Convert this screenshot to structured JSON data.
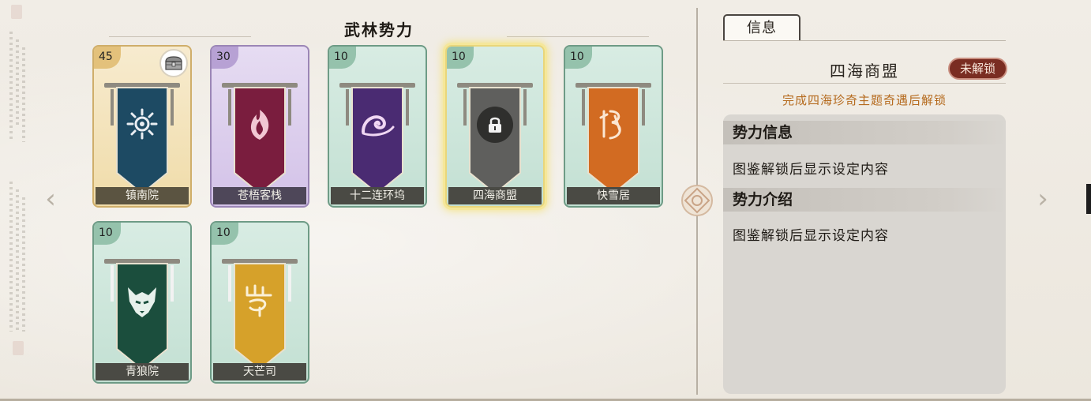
{
  "header": {
    "title": "武林势力"
  },
  "factions": [
    {
      "name": "镇南院",
      "level": "45",
      "theme": "gold",
      "emblem": "sun-emblem-icon",
      "banner_color": "#1d4a63",
      "has_reward": true
    },
    {
      "name": "苍梧客栈",
      "level": "30",
      "theme": "purple",
      "emblem": "phoenix-flame-icon",
      "banner_color": "#7a1d3e",
      "has_reward": false
    },
    {
      "name": "十二连环坞",
      "level": "10",
      "theme": "green",
      "emblem": "wave-swirl-icon",
      "banner_color": "#4a2b72",
      "has_reward": false
    },
    {
      "name": "四海商盟",
      "level": "10",
      "theme": "green",
      "emblem": "padlock-icon",
      "banner_color": "#5f5f5d",
      "has_reward": false,
      "selected": true
    },
    {
      "name": "快雪居",
      "level": "10",
      "theme": "green",
      "emblem": "snow-glyph-icon",
      "banner_color": "#d26b22",
      "has_reward": false
    },
    {
      "name": "青狼院",
      "level": "10",
      "theme": "green",
      "emblem": "wolf-head-icon",
      "banner_color": "#1b4e3d",
      "has_reward": false
    },
    {
      "name": "天芒司",
      "level": "10",
      "theme": "green",
      "emblem": "sky-glyph-icon",
      "banner_color": "#d6a12a",
      "has_reward": false
    }
  ],
  "detail": {
    "tab_label": "信息",
    "faction_name": "四海商盟",
    "status_badge": "未解锁",
    "unlock_hint": "完成四海珍奇主题奇遇后解锁",
    "sections": [
      {
        "heading": "势力信息",
        "body": "图鉴解锁后显示设定内容"
      },
      {
        "heading": "势力介绍",
        "body": "图鉴解锁后显示设定内容"
      }
    ]
  },
  "colors": {
    "accent_gold": "#e9d67a",
    "lock_badge": "#7a2d22",
    "hint_text": "#b56a1d"
  },
  "icons": {
    "prev": "chevron-left-icon",
    "next": "chevron-right-icon",
    "center": "ornament-knot-icon",
    "reward": "treasure-chest-icon"
  }
}
